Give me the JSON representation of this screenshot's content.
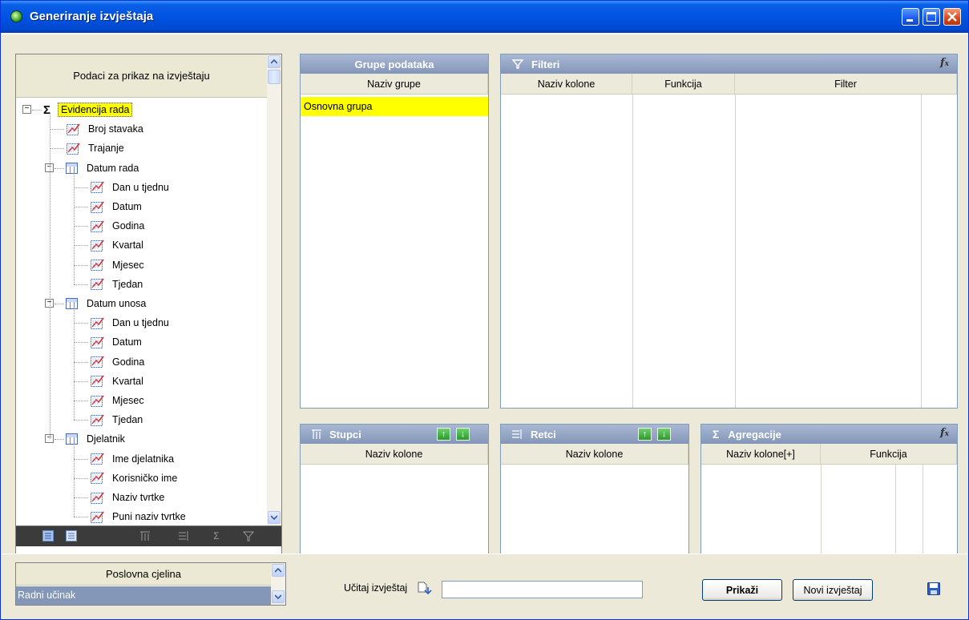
{
  "window": {
    "title": "Generiranje izvještaja",
    "controls": [
      "minimize",
      "maximize",
      "close"
    ]
  },
  "left_panel": {
    "header": "Podaci za prikaz na izvještaju",
    "tree": [
      {
        "label": "Evidencija rada",
        "icon": "sigma-icon",
        "level": 0,
        "expander": "minus",
        "selected": true
      },
      {
        "label": "Broj stavaka",
        "icon": "field-icon",
        "level": 1
      },
      {
        "label": "Trajanje",
        "icon": "field-icon",
        "level": 1
      },
      {
        "label": "Datum rada",
        "icon": "table-icon",
        "level": 1,
        "expander": "minus"
      },
      {
        "label": "Dan u tjednu",
        "icon": "field-icon",
        "level": 2
      },
      {
        "label": "Datum",
        "icon": "field-icon",
        "level": 2
      },
      {
        "label": "Godina",
        "icon": "field-icon",
        "level": 2
      },
      {
        "label": "Kvartal",
        "icon": "field-icon",
        "level": 2
      },
      {
        "label": "Mjesec",
        "icon": "field-icon",
        "level": 2
      },
      {
        "label": "Tjedan",
        "icon": "field-icon",
        "level": 2
      },
      {
        "label": "Datum unosa",
        "icon": "table-icon",
        "level": 1,
        "expander": "minus"
      },
      {
        "label": "Dan u tjednu",
        "icon": "field-icon",
        "level": 2
      },
      {
        "label": "Datum",
        "icon": "field-icon",
        "level": 2
      },
      {
        "label": "Godina",
        "icon": "field-icon",
        "level": 2
      },
      {
        "label": "Kvartal",
        "icon": "field-icon",
        "level": 2
      },
      {
        "label": "Mjesec",
        "icon": "field-icon",
        "level": 2
      },
      {
        "label": "Tjedan",
        "icon": "field-icon",
        "level": 2
      },
      {
        "label": "Djelatnik",
        "icon": "table-icon",
        "level": 1,
        "expander": "minus"
      },
      {
        "label": "Ime djelatnika",
        "icon": "field-icon",
        "level": 2
      },
      {
        "label": "Korisničko ime",
        "icon": "field-icon",
        "level": 2
      },
      {
        "label": "Naziv tvrtke",
        "icon": "field-icon",
        "level": 2
      },
      {
        "label": "Puni naziv tvrtke",
        "icon": "field-icon",
        "level": 2
      }
    ],
    "toolbar_icons": [
      "expand-all-icon",
      "collapse-all-icon",
      "add-to-columns-icon",
      "add-to-rows-icon",
      "add-to-aggregation-icon",
      "add-to-filter-icon"
    ]
  },
  "groups": {
    "title": "Grupe podataka",
    "column": "Naziv grupe",
    "rows": [
      "Osnovna grupa"
    ]
  },
  "filters": {
    "title": "Filteri",
    "columns": [
      "Naziv kolone",
      "Funkcija",
      "Filter"
    ]
  },
  "columns_panel": {
    "title": "Stupci",
    "column": "Naziv kolone"
  },
  "rows_panel": {
    "title": "Retci",
    "column": "Naziv kolone"
  },
  "aggregations": {
    "title": "Agregacije",
    "columns": [
      "Naziv kolone[+]",
      "Funkcija"
    ]
  },
  "business_unit": {
    "header": "Poslovna cjelina",
    "value": "Radni učinak"
  },
  "load_report": {
    "label": "Učitaj izvještaj",
    "value": ""
  },
  "buttons": {
    "show": "Prikaži",
    "new_report": "Novi izvještaj"
  },
  "colors": {
    "selection": "#ffff00",
    "panel_title": "#8d9fbf",
    "title_bar": "#0054e3"
  }
}
